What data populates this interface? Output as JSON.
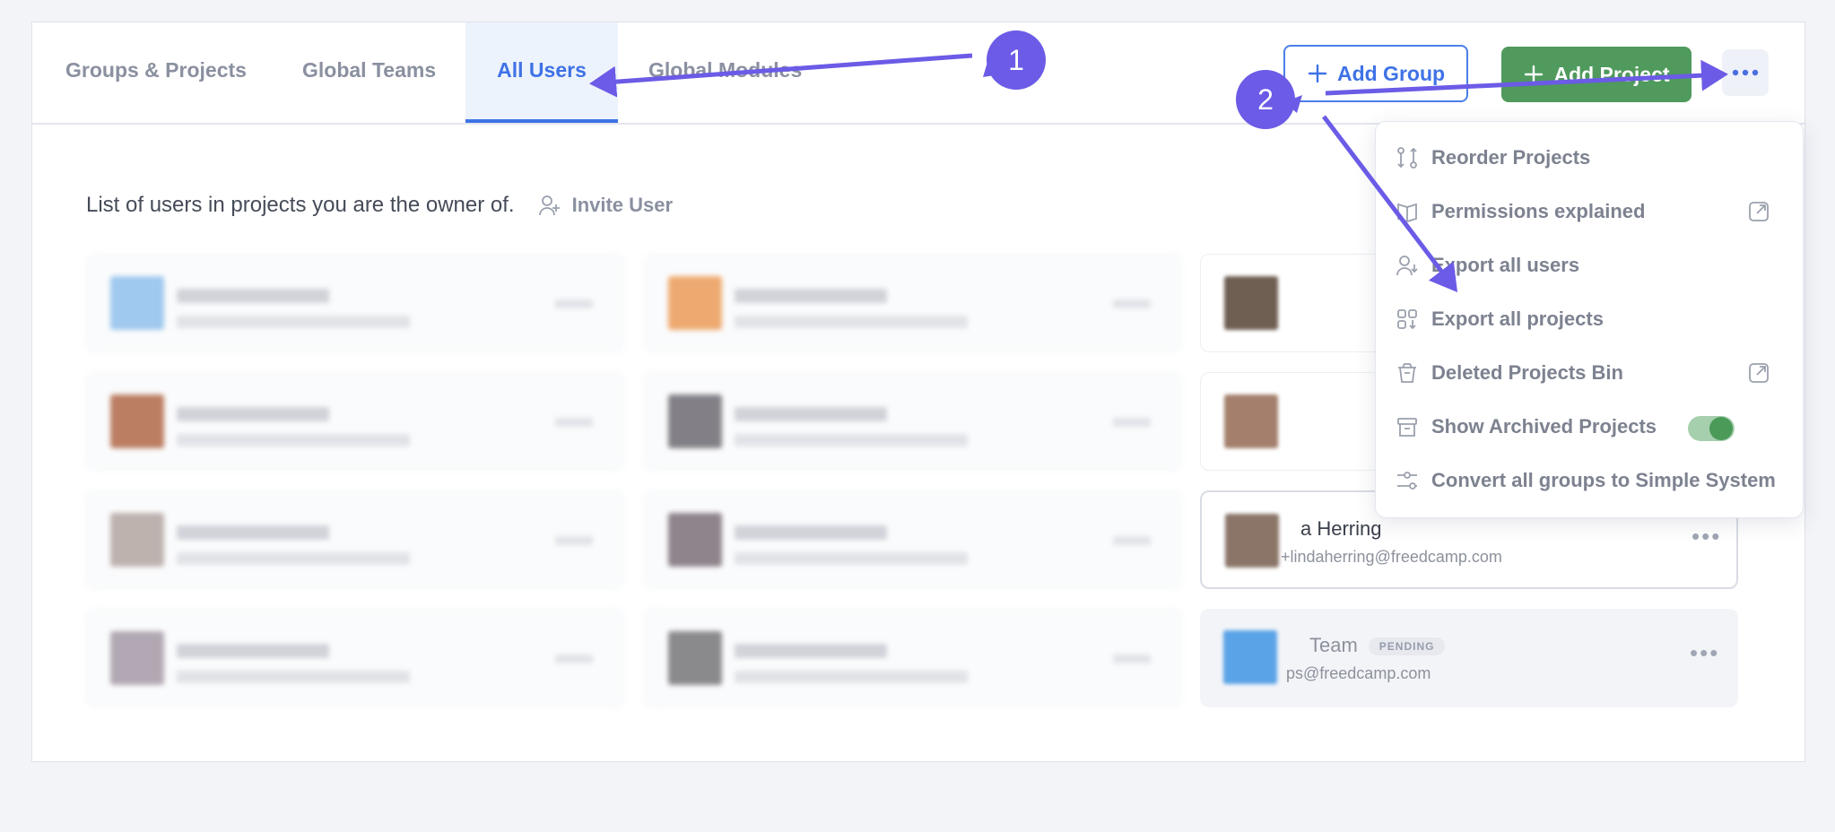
{
  "tabs": [
    {
      "label": "Groups & Projects"
    },
    {
      "label": "Global Teams"
    },
    {
      "label": "All Users"
    },
    {
      "label": "Global Modules"
    }
  ],
  "header": {
    "add_group_label": "Add Group",
    "add_project_label": "Add Project"
  },
  "intro": {
    "text": "List of users in projects you are the owner of.",
    "invite_label": "Invite User"
  },
  "users": {
    "linda": {
      "name": "a Herring",
      "email": "+lindaherring@freedcamp.com"
    },
    "team": {
      "name": "Team",
      "badge": "PENDING",
      "email": "ps@freedcamp.com"
    }
  },
  "menu": {
    "items": [
      {
        "label": "Reorder Projects"
      },
      {
        "label": "Permissions explained"
      },
      {
        "label": "Export all users"
      },
      {
        "label": "Export all projects"
      },
      {
        "label": "Deleted Projects Bin"
      },
      {
        "label": "Show Archived Projects"
      },
      {
        "label": "Convert all groups to Simple System"
      }
    ],
    "archived_toggle_on": true
  },
  "annotations": {
    "step1": "1",
    "step2": "2",
    "color": "#6b5be6"
  },
  "colors": {
    "accent": "#3f72e6",
    "add_project_green": "#4f9a5c"
  }
}
